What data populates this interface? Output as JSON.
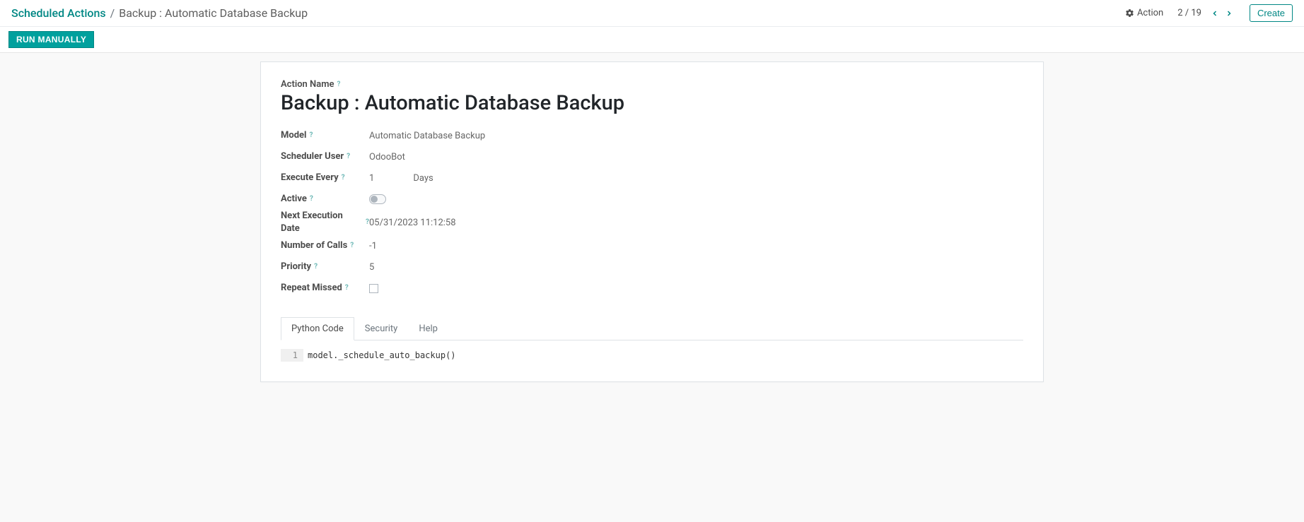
{
  "header": {
    "breadcrumb_root": "Scheduled Actions",
    "breadcrumb_sep": "/",
    "breadcrumb_current": "Backup : Automatic Database Backup",
    "action_label": "Action",
    "pager_text": "2 / 19",
    "create_label": "Create"
  },
  "statusbar": {
    "run_label": "RUN MANUALLY"
  },
  "form": {
    "title_label": "Action Name",
    "title_value": "Backup : Automatic Database Backup",
    "fields": {
      "model": {
        "label": "Model",
        "value": "Automatic Database Backup"
      },
      "user": {
        "label": "Scheduler User",
        "value": "OdooBot"
      },
      "every": {
        "label": "Execute Every",
        "number": "1",
        "unit": "Days"
      },
      "active": {
        "label": "Active",
        "value": false
      },
      "next": {
        "label": "Next Execution Date",
        "value": "05/31/2023 11:12:58"
      },
      "calls": {
        "label": "Number of Calls",
        "value": "-1"
      },
      "priority": {
        "label": "Priority",
        "value": "5"
      },
      "repeat": {
        "label": "Repeat Missed",
        "value": false
      }
    }
  },
  "tabs": {
    "code": "Python Code",
    "security": "Security",
    "help": "Help",
    "active": "code"
  },
  "editor": {
    "line_no": "1",
    "line": "model._schedule_auto_backup()"
  },
  "glyphs": {
    "help": "?"
  }
}
